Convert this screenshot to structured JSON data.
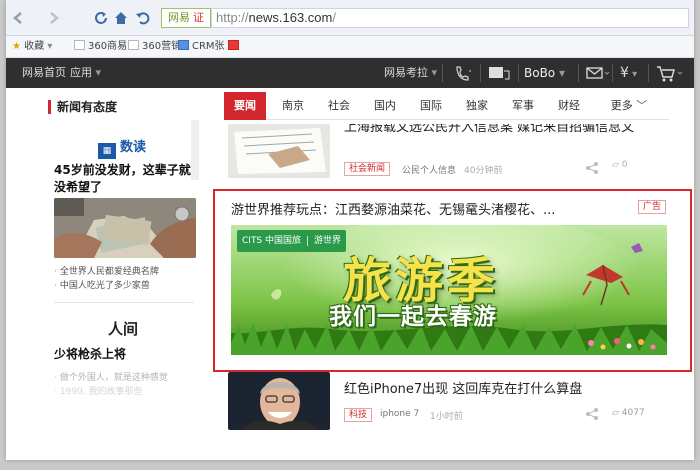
{
  "browser": {
    "nav_icons": [
      "back-icon",
      "forward-icon",
      "refresh-icon",
      "home-icon",
      "undo-icon"
    ],
    "site_tag": "网易",
    "site_tag_badge": "证",
    "url_prefix": "http://",
    "url_host": "news.163.com",
    "url_suffix": "/"
  },
  "bookmarks": [
    "收藏",
    "360商易",
    "360营销",
    "CRM张"
  ],
  "site_nav": {
    "home": "网易首页",
    "apps": "应用",
    "exam": "网易考拉",
    "user": "BoBo",
    "icons": [
      "phone-icon",
      "message-icon",
      "mail-icon",
      "yen-icon",
      "cart-icon"
    ]
  },
  "left": {
    "section_title": "新闻有态度",
    "shudu_logo": "数读",
    "headline1": "45岁前没发财，这辈子就没希望了",
    "items1": [
      "全世界人民都爱经典名牌",
      "中国人吃光了多少家兽"
    ],
    "renjian_logo": "人间",
    "headline2": "少将枪杀上将",
    "items2": [
      "做个外国人，就是这种感觉",
      "1990, 我的故事那些"
    ]
  },
  "tabs": [
    "要闻",
    "南京",
    "社会",
    "国内",
    "国际",
    "独家",
    "军事",
    "财经",
    "更多"
  ],
  "news_top": {
    "title_partial": "上海报载文选公民开入信息案 媒记来自招骗信息文",
    "tag": "社会新闻",
    "source": "公民个人信息",
    "time": "40分钟前",
    "comments": "0"
  },
  "ad": {
    "title": "游世界推荐玩点：江西婺源油菜花、无锡鼋头渚樱花、...",
    "badge": "广告",
    "banner_logo": "CITS 中国国旅",
    "banner_logo_sub": "游世界",
    "banner_title": "旅游季",
    "banner_sub": "我们一起去春游"
  },
  "news_bottom": {
    "title": "红色iPhone7出现 这回库克在打什么算盘",
    "tag": "科技",
    "source": "iphone 7",
    "time": "1小时前",
    "comments": "4077"
  }
}
